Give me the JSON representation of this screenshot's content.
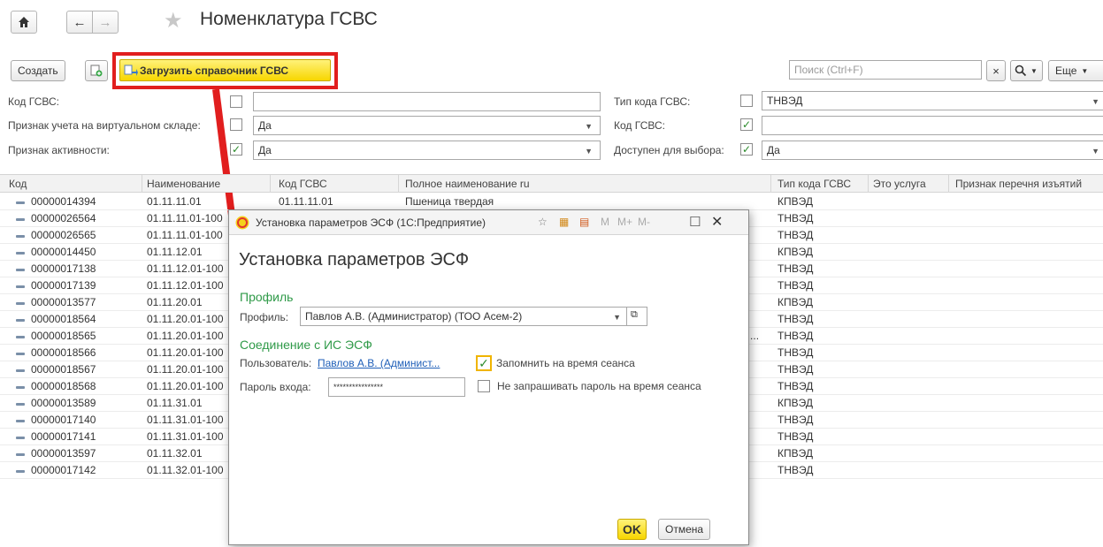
{
  "header": {
    "title": "Номенклатура ГСВС",
    "home_icon": "home-icon",
    "back_icon": "arrow-left-icon",
    "forward_icon": "arrow-right-icon",
    "favorite_icon": "star-icon"
  },
  "toolbar": {
    "create_label": "Создать",
    "load_label": "Загрузить справочник ГСВС",
    "search_placeholder": "Поиск (Ctrl+F)",
    "clear_label": "×",
    "more_label": "Еще"
  },
  "filters": {
    "code_label": "Код ГСВС:",
    "code_value": "",
    "virtual_label": "Признак учета на виртуальном складе:",
    "virtual_value": "Да",
    "active_label": "Признак активности:",
    "active_value": "Да",
    "type_label": "Тип кода ГСВС:",
    "type_value": "ТНВЭД",
    "code2_label": "Код ГСВС:",
    "code2_value": "",
    "available_label": "Доступен для выбора:",
    "available_value": "Да"
  },
  "table": {
    "columns": [
      "Код",
      "Наименование",
      "Код ГСВС",
      "Полное наименование ru",
      "Тип кода ГСВС",
      "Это услуга",
      "Признак перечня изъятий"
    ],
    "rows": [
      {
        "code": "00000014394",
        "name": "01.11.11.01",
        "gsvs": "01.11.11.01",
        "full": "Пшеница твердая",
        "type": "КПВЭД"
      },
      {
        "code": "00000026564",
        "name": "01.11.11.01-100",
        "gsvs": "",
        "full": "",
        "type": "ТНВЭД"
      },
      {
        "code": "00000026565",
        "name": "01.11.11.01-100",
        "gsvs": "",
        "full": "",
        "type": "ТНВЭД"
      },
      {
        "code": "00000014450",
        "name": "01.11.12.01",
        "gsvs": "",
        "full": "",
        "type": "КПВЭД"
      },
      {
        "code": "00000017138",
        "name": "01.11.12.01-100",
        "gsvs": "",
        "full": "",
        "type": "ТНВЭД"
      },
      {
        "code": "00000017139",
        "name": "01.11.12.01-100",
        "gsvs": "",
        "full": "",
        "type": "ТНВЭД"
      },
      {
        "code": "00000013577",
        "name": "01.11.20.01",
        "gsvs": "",
        "full": "",
        "type": "КПВЭД"
      },
      {
        "code": "00000018564",
        "name": "01.11.20.01-100",
        "gsvs": "",
        "full": "",
        "type": "ТНВЭД"
      },
      {
        "code": "00000018565",
        "name": "01.11.20.01-100",
        "gsvs": "",
        "full": "и ...",
        "type": "ТНВЭД"
      },
      {
        "code": "00000018566",
        "name": "01.11.20.01-100",
        "gsvs": "",
        "full": "",
        "type": "ТНВЭД"
      },
      {
        "code": "00000018567",
        "name": "01.11.20.01-100",
        "gsvs": "",
        "full": "",
        "type": "ТНВЭД"
      },
      {
        "code": "00000018568",
        "name": "01.11.20.01-100",
        "gsvs": "",
        "full": "",
        "type": "ТНВЭД"
      },
      {
        "code": "00000013589",
        "name": "01.11.31.01",
        "gsvs": "",
        "full": "",
        "type": "КПВЭД"
      },
      {
        "code": "00000017140",
        "name": "01.11.31.01-100",
        "gsvs": "",
        "full": "",
        "type": "ТНВЭД"
      },
      {
        "code": "00000017141",
        "name": "01.11.31.01-100",
        "gsvs": "",
        "full": "",
        "type": "ТНВЭД"
      },
      {
        "code": "00000013597",
        "name": "01.11.32.01",
        "gsvs": "",
        "full": "",
        "type": "КПВЭД"
      },
      {
        "code": "00000017142",
        "name": "01.11.32.01-100",
        "gsvs": "",
        "full": "",
        "type": "ТНВЭД"
      }
    ]
  },
  "dialog": {
    "window_title": "Установка параметров ЭСФ (1С:Предприятие)",
    "heading": "Установка параметров ЭСФ",
    "profile_section": "Профиль",
    "profile_label": "Профиль:",
    "profile_value": "Павлов А.В. (Администратор) (ТОО Асем-2)",
    "connection_section": "Соединение с ИС ЭСФ",
    "user_label": "Пользователь:",
    "user_value": "Павлов А.В. (Админист...",
    "remember_label": "Запомнить на время сеанса",
    "password_label": "Пароль входа:",
    "password_value": "****************",
    "no_ask_label": "Не запрашивать пароль на время сеанса",
    "ok_label": "OK",
    "cancel_label": "Отмена",
    "m_label": "M",
    "mplus_label": "M+",
    "mminus_label": "M-"
  },
  "colors": {
    "highlight": "#e11e1e",
    "accent_yellow": "#f7d600",
    "section_green": "#2f9a48",
    "link_blue": "#1f5fb8"
  }
}
